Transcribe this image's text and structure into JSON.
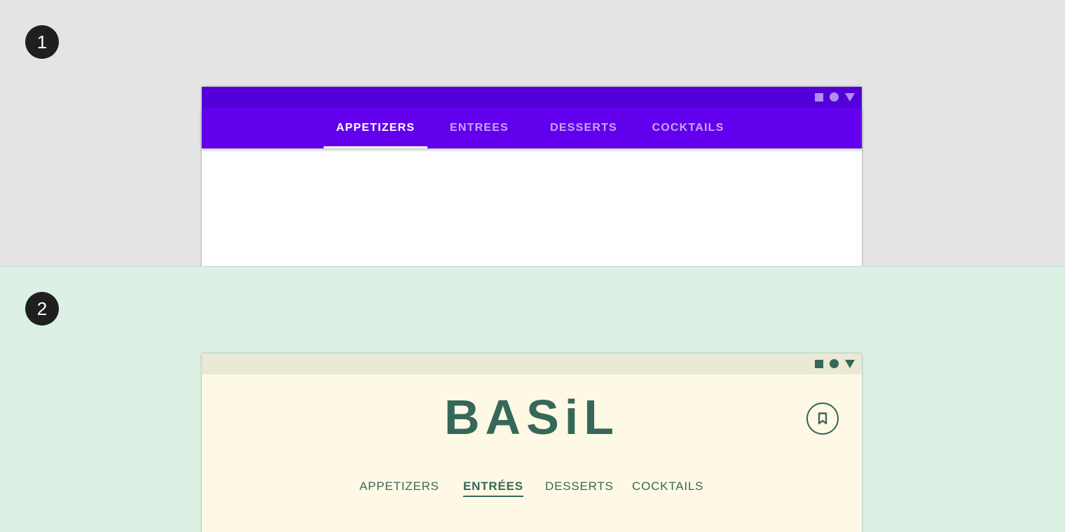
{
  "steps": [
    "1",
    "2"
  ],
  "variant_material": {
    "colors": {
      "status_bar": "#5300d8",
      "app_bar": "#6200ee",
      "active_tab": "#ffffff",
      "inactive_tab": "#c9a4f7"
    },
    "status_icons": [
      "square-icon",
      "circle-icon",
      "triangle-icon"
    ],
    "tabs": [
      {
        "label": "APPETIZERS",
        "active": true
      },
      {
        "label": "ENTREES",
        "active": false
      },
      {
        "label": "DESSERTS",
        "active": false
      },
      {
        "label": "COCKTAILS",
        "active": false
      }
    ]
  },
  "variant_basil": {
    "colors": {
      "status_bar": "#eae9d6",
      "background": "#fef9e4",
      "primary": "#356859"
    },
    "status_icons": [
      "square-icon",
      "circle-icon",
      "triangle-icon"
    ],
    "brand": "BASiL",
    "action_icon": "bookmark-icon",
    "tabs": [
      {
        "label": "APPETIZERS",
        "active": false
      },
      {
        "label": "ENTRÉES",
        "active": true
      },
      {
        "label": "DESSERTS",
        "active": false
      },
      {
        "label": "COCKTAILS",
        "active": false
      }
    ]
  }
}
